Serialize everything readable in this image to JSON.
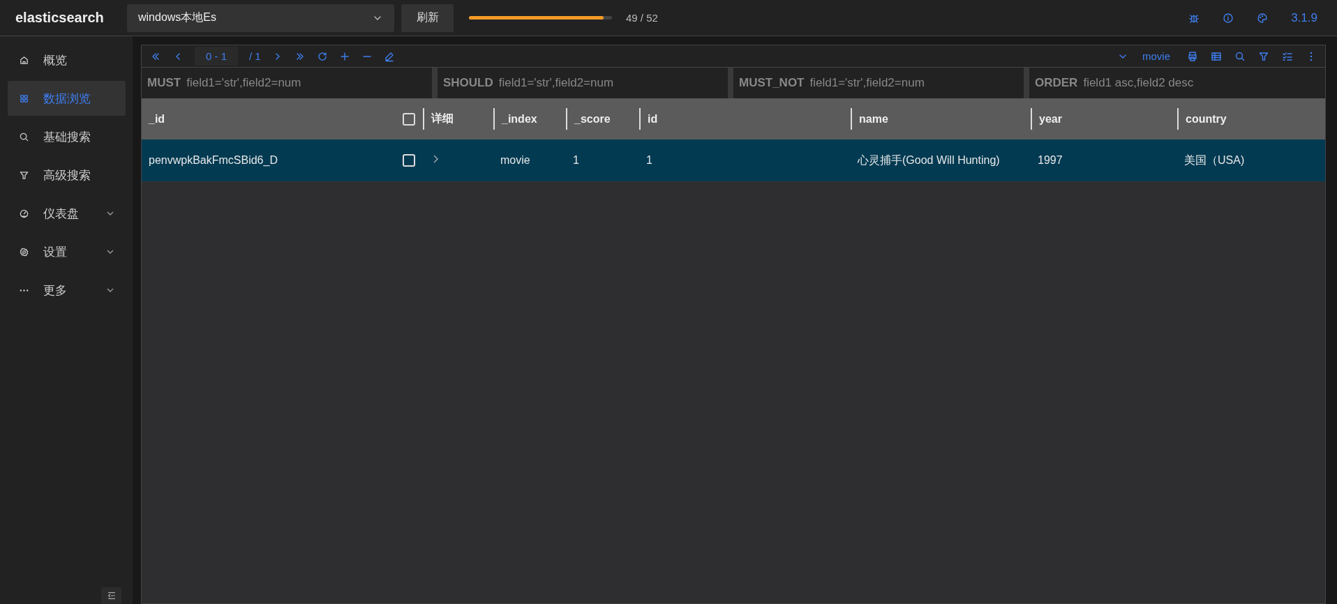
{
  "app": {
    "logo": "elasticsearch",
    "connection": {
      "value": "windows本地Es"
    },
    "refresh_button": "刷新",
    "progress": {
      "level": 0.94,
      "reading": "49 / 52"
    },
    "version": "3.1.9"
  },
  "sidebar": {
    "items": [
      {
        "label": "概览",
        "selected": false,
        "expandable": false
      },
      {
        "label": "数据浏览",
        "selected": true,
        "expandable": false
      },
      {
        "label": "基础搜索",
        "selected": false,
        "expandable": false
      },
      {
        "label": "高级搜索",
        "selected": false,
        "expandable": false
      },
      {
        "label": "仪表盘",
        "selected": false,
        "expandable": true
      },
      {
        "label": "设置",
        "selected": false,
        "expandable": true
      },
      {
        "label": "更多",
        "selected": false,
        "expandable": true
      }
    ]
  },
  "toolbar": {
    "page_range": "0 - 1",
    "page_total": "/ 1",
    "index": "movie"
  },
  "query": [
    {
      "label": "MUST",
      "placeholder": "field1='str',field2=num"
    },
    {
      "label": "SHOULD",
      "placeholder": "field1='str',field2=num"
    },
    {
      "label": "MUST_NOT",
      "placeholder": "field1='str',field2=num"
    },
    {
      "label": "ORDER",
      "placeholder": "field1 asc,field2 desc"
    }
  ],
  "table": {
    "columns": [
      "_id",
      "详细",
      "_index",
      "_score",
      "id",
      "name",
      "year",
      "country"
    ],
    "all_checked": false,
    "rows": [
      {
        "checked": false,
        "expanded": false,
        "cells": [
          "penvwpkBakFmcSBid6_D",
          "",
          "movie",
          "1",
          "1",
          "心灵捕手(Good Will Hunting)",
          "1997",
          "美国（USA)"
        ]
      }
    ]
  }
}
